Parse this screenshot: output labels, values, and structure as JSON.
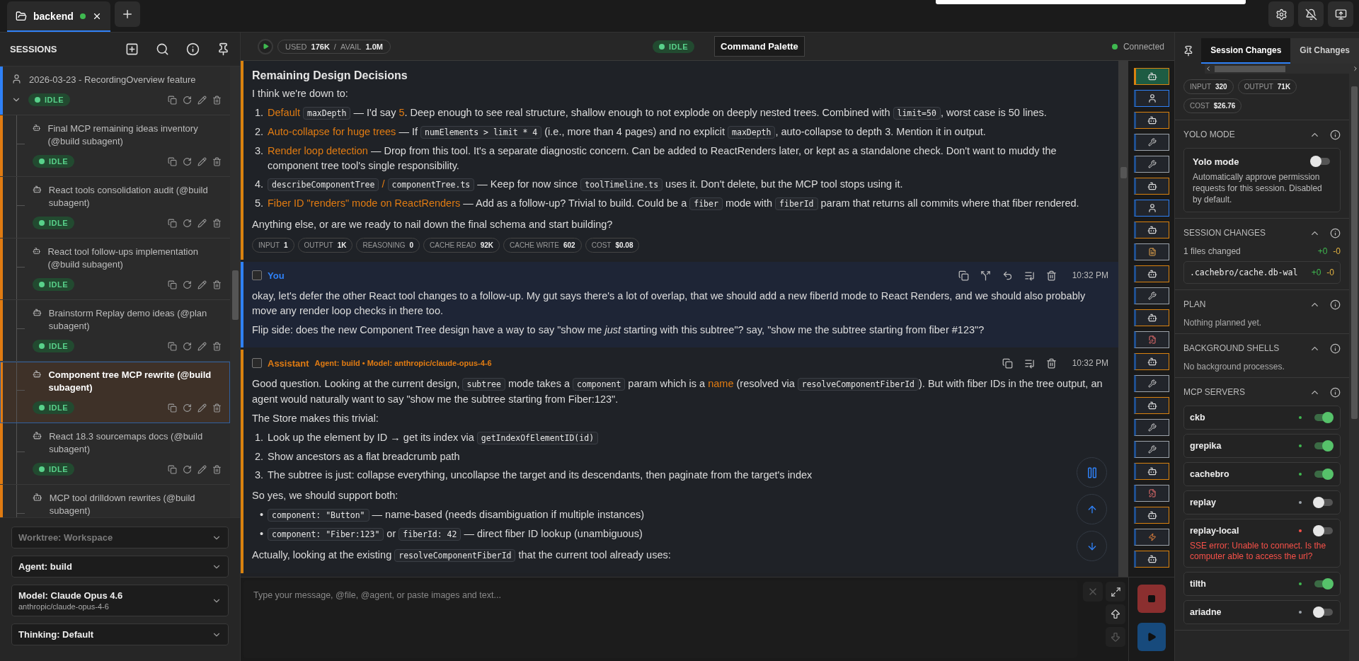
{
  "top_bar": {
    "tabs": [
      {
        "label": "backend",
        "selected": true
      }
    ]
  },
  "sidebar": {
    "title": "SESSIONS",
    "sessions": [
      {
        "kind": "user",
        "title": "2026-03-23 - RecordingOverview feature",
        "status": "IDLE",
        "expanded": true,
        "selected": false,
        "children": [
          {
            "kind": "subagent",
            "title": "Final MCP remaining ideas inventory (@build subagent)",
            "status": "IDLE",
            "selected": false
          },
          {
            "kind": "subagent",
            "title": "React tools consolidation audit (@build subagent)",
            "status": "IDLE",
            "selected": false
          },
          {
            "kind": "subagent",
            "title": "React tool follow-ups implementation (@build subagent)",
            "status": "IDLE",
            "selected": false
          },
          {
            "kind": "subagent",
            "title": "Brainstorm Replay demo ideas (@plan subagent)",
            "status": "IDLE",
            "selected": false
          },
          {
            "kind": "subagent",
            "title": "Component tree MCP rewrite (@build subagent)",
            "status": "IDLE",
            "selected": true
          },
          {
            "kind": "subagent",
            "title": "React 18.3 sourcemaps docs (@build subagent)",
            "status": "IDLE",
            "selected": false
          },
          {
            "kind": "subagent",
            "title": "MCP tool drilldown rewrites (@build subagent)",
            "selected": false
          }
        ]
      }
    ],
    "selects": [
      {
        "label": "Worktree: Workspace",
        "disabled": true
      },
      {
        "label": "Agent: build",
        "disabled": false
      },
      {
        "label": "Model: Claude Opus 4.6",
        "sub": "anthropic/claude-opus-4-6",
        "disabled": false
      },
      {
        "label": "Thinking: Default",
        "disabled": false
      }
    ]
  },
  "header": {
    "used_label": "USED",
    "used": "176K",
    "separator": "/",
    "avail_label": "AVAIL",
    "avail": "1.0M",
    "status": "IDLE",
    "command_palette": "Command Palette",
    "connection": "Connected"
  },
  "messages": [
    {
      "kind": "assistant",
      "blocks": [
        {
          "kind": "heading",
          "text": "Remaining Design Decisions"
        },
        {
          "kind": "para",
          "segments": [
            {
              "kind": "text",
              "text": "I think we're down to:"
            }
          ]
        },
        {
          "kind": "list",
          "items": [
            {
              "marker": "1.",
              "segments": [
                {
                  "kind": "accent",
                  "text": "Default "
                },
                {
                  "kind": "code",
                  "text": "maxDepth"
                },
                {
                  "kind": "text",
                  "text": " — I'd say "
                },
                {
                  "kind": "accent",
                  "text": "5"
                },
                {
                  "kind": "text",
                  "text": ". Deep enough to see real structure, shallow enough to not explode on deeply nested trees. Combined with "
                },
                {
                  "kind": "code",
                  "text": "limit=50"
                },
                {
                  "kind": "text",
                  "text": ", worst case is 50 lines."
                }
              ]
            },
            {
              "marker": "2.",
              "segments": [
                {
                  "kind": "accent",
                  "text": "Auto-collapse for huge trees"
                },
                {
                  "kind": "text",
                  "text": " — If "
                },
                {
                  "kind": "code",
                  "text": "numElements > limit * 4"
                },
                {
                  "kind": "text",
                  "text": " (i.e., more than 4 pages) and no explicit "
                },
                {
                  "kind": "code",
                  "text": "maxDepth"
                },
                {
                  "kind": "text",
                  "text": ", auto-collapse to depth 3. Mention it in output."
                }
              ]
            },
            {
              "marker": "3.",
              "segments": [
                {
                  "kind": "accent",
                  "text": "Render loop detection"
                },
                {
                  "kind": "text",
                  "text": " — Drop from this tool. It's a separate diagnostic concern. Can be added to ReactRenders later, or kept as a standalone check. Don't want to muddy the component tree tool's single responsibility."
                }
              ]
            },
            {
              "marker": "4.",
              "segments": [
                {
                  "kind": "code",
                  "text": "describeComponentTree"
                },
                {
                  "kind": "accent",
                  "text": " / "
                },
                {
                  "kind": "code",
                  "text": "componentTree.ts"
                },
                {
                  "kind": "text",
                  "text": " — Keep for now since "
                },
                {
                  "kind": "code",
                  "text": "toolTimeline.ts"
                },
                {
                  "kind": "text",
                  "text": " uses it. Don't delete, but the MCP tool stops using it."
                }
              ]
            },
            {
              "marker": "5.",
              "segments": [
                {
                  "kind": "accent",
                  "text": "Fiber ID \"renders\" mode on ReactRenders"
                },
                {
                  "kind": "text",
                  "text": " — Add as a follow-up? Trivial to build. Could be a "
                },
                {
                  "kind": "code",
                  "text": "fiber"
                },
                {
                  "kind": "text",
                  "text": " mode with "
                },
                {
                  "kind": "code",
                  "text": "fiberId"
                },
                {
                  "kind": "text",
                  "text": " param that returns all commits where that fiber rendered."
                }
              ]
            }
          ]
        },
        {
          "kind": "para",
          "segments": [
            {
              "kind": "text",
              "text": "Anything else, or are we ready to nail down the final schema and start building?"
            }
          ]
        },
        {
          "kind": "stats",
          "chips": [
            {
              "label": "INPUT",
              "value": "1"
            },
            {
              "label": "OUTPUT",
              "value": "1K"
            },
            {
              "label": "REASONING",
              "value": "0"
            },
            {
              "label": "CACHE READ",
              "value": "92K"
            },
            {
              "label": "CACHE WRITE",
              "value": "602"
            },
            {
              "label": "COST",
              "value": "$0.08"
            }
          ]
        }
      ]
    },
    {
      "kind": "user",
      "author": "You",
      "time": "10:32 PM",
      "checked": false,
      "blocks": [
        {
          "kind": "para",
          "segments": [
            {
              "kind": "text",
              "text": "okay, let's defer the other React tool changes to a follow-up. My gut says there's a lot of overlap, that we should add a new fiberId mode to React Renders, and we should also probably move any render loop checks in there too."
            }
          ]
        },
        {
          "kind": "para",
          "segments": [
            {
              "kind": "text",
              "text": "Flip side: does the new Component Tree design have a way to say \"show me *just* starting with this subtree\"? say, \"show me the subtree starting from fiber #123\"?"
            }
          ]
        }
      ]
    },
    {
      "kind": "assistant",
      "author": "Assistant",
      "meta": "Agent: build • Model: anthropic/claude-opus-4-6",
      "time": "10:32 PM",
      "checked": false,
      "blocks": [
        {
          "kind": "para",
          "segments": [
            {
              "kind": "text",
              "text": "Good question. Looking at the current design, "
            },
            {
              "kind": "code",
              "text": "subtree"
            },
            {
              "kind": "text",
              "text": " mode takes a "
            },
            {
              "kind": "code",
              "text": "component"
            },
            {
              "kind": "text",
              "text": " param which is a "
            },
            {
              "kind": "accent",
              "text": "name"
            },
            {
              "kind": "text",
              "text": " (resolved via "
            },
            {
              "kind": "code",
              "text": "resolveComponentFiberId"
            },
            {
              "kind": "text",
              "text": "). But with fiber IDs in the tree output, an agent would naturally want to say \"show me the subtree starting from Fiber:123\"."
            }
          ]
        },
        {
          "kind": "para",
          "segments": [
            {
              "kind": "text",
              "text": "The Store makes this trivial:"
            }
          ]
        },
        {
          "kind": "list",
          "items": [
            {
              "marker": "1.",
              "segments": [
                {
                  "kind": "text",
                  "text": "Look up the element by ID → get its index via "
                },
                {
                  "kind": "code",
                  "text": "getIndexOfElementID(id)"
                }
              ]
            },
            {
              "marker": "2.",
              "segments": [
                {
                  "kind": "text",
                  "text": "Show ancestors as a flat breadcrumb path"
                }
              ]
            },
            {
              "marker": "3.",
              "segments": [
                {
                  "kind": "text",
                  "text": "The subtree is just: collapse everything, uncollapse the target and its descendants, then paginate from the target's index"
                }
              ]
            }
          ]
        },
        {
          "kind": "para",
          "segments": [
            {
              "kind": "text",
              "text": "So yes, we should support both:"
            }
          ]
        },
        {
          "kind": "list",
          "items": [
            {
              "marker": "•",
              "segments": [
                {
                  "kind": "code",
                  "text": "component: \"Button\""
                },
                {
                  "kind": "text",
                  "text": " — name-based (needs disambiguation if multiple instances)"
                }
              ]
            },
            {
              "marker": "•",
              "segments": [
                {
                  "kind": "code",
                  "text": "component: \"Fiber:123\""
                },
                {
                  "kind": "text",
                  "text": " or "
                },
                {
                  "kind": "code",
                  "text": "fiberId: 42"
                },
                {
                  "kind": "text",
                  "text": " — direct fiber ID lookup (unambiguous)"
                }
              ]
            }
          ]
        },
        {
          "kind": "para",
          "segments": [
            {
              "kind": "text",
              "text": "Actually, looking at the existing "
            },
            {
              "kind": "code",
              "text": "resolveComponentFiberId"
            },
            {
              "kind": "text",
              "text": " that the current tool already uses:"
            }
          ]
        }
      ]
    }
  ],
  "timeline": [
    {
      "kind": "agent",
      "selected": true,
      "color": "#d9820f"
    },
    {
      "kind": "user",
      "selected": false,
      "color": "#2f81f7"
    },
    {
      "kind": "agent",
      "selected": false,
      "color": "#d9820f"
    },
    {
      "kind": "tool",
      "selected": false,
      "color": "#9ca3ab"
    },
    {
      "kind": "tool",
      "selected": false,
      "color": "#9ca3ab"
    },
    {
      "kind": "agent",
      "selected": false,
      "color": "#d9820f"
    },
    {
      "kind": "user",
      "selected": false,
      "color": "#2f81f7"
    },
    {
      "kind": "agent",
      "selected": false,
      "color": "#d9820f"
    },
    {
      "kind": "file",
      "selected": false,
      "color": "#9ca3ab"
    },
    {
      "kind": "agent",
      "selected": false,
      "color": "#d9820f"
    },
    {
      "kind": "tool",
      "selected": false,
      "color": "#9ca3ab"
    },
    {
      "kind": "agent",
      "selected": false,
      "color": "#d9820f"
    },
    {
      "kind": "edit",
      "selected": false,
      "color": "#9ca3ab"
    },
    {
      "kind": "agent",
      "selected": false,
      "color": "#d9820f"
    },
    {
      "kind": "tool",
      "selected": false,
      "color": "#9ca3ab"
    },
    {
      "kind": "agent",
      "selected": false,
      "color": "#d9820f"
    },
    {
      "kind": "tool",
      "selected": false,
      "color": "#9ca3ab"
    },
    {
      "kind": "tool",
      "selected": false,
      "color": "#9ca3ab"
    },
    {
      "kind": "agent",
      "selected": false,
      "color": "#d9820f"
    },
    {
      "kind": "edit",
      "selected": false,
      "color": "#9ca3ab"
    },
    {
      "kind": "agent",
      "selected": false,
      "color": "#d9820f"
    },
    {
      "kind": "event",
      "selected": false,
      "color": "#9ca3ab"
    },
    {
      "kind": "agent",
      "selected": false,
      "color": "#d9820f"
    }
  ],
  "composer": {
    "placeholder": "Type your message, @file, @agent, or paste images and text..."
  },
  "right_panel": {
    "tabs": [
      {
        "label": "Session Changes",
        "selected": true
      },
      {
        "label": "Git Changes",
        "selected": false
      }
    ],
    "stats": [
      {
        "label": "INPUT",
        "value": "320"
      },
      {
        "label": "OUTPUT",
        "value": "71K"
      },
      {
        "label": "COST",
        "value": "$26.76"
      }
    ],
    "sections": [
      {
        "kind": "toggle_card",
        "title": "YOLO MODE",
        "expanded": true,
        "card": {
          "title": "Yolo mode",
          "description": "Automatically approve permission requests for this session. Disabled by default.",
          "on": false
        }
      },
      {
        "kind": "changes",
        "title": "SESSION CHANGES",
        "expanded": true,
        "summary": "1 files changed",
        "added": "+0",
        "removed": "-0",
        "files": [
          {
            "path": ".cachebro/cache.db-wal",
            "added": "+0",
            "removed": "-0"
          }
        ]
      },
      {
        "kind": "note",
        "title": "PLAN",
        "expanded": true,
        "text": "Nothing planned yet."
      },
      {
        "kind": "note",
        "title": "BACKGROUND SHELLS",
        "expanded": true,
        "text": "No background processes."
      },
      {
        "kind": "servers",
        "title": "MCP SERVERS",
        "expanded": true,
        "servers": [
          {
            "name": "ckb",
            "color": "#3fb950",
            "on": true
          },
          {
            "name": "grepika",
            "color": "#3fb950",
            "on": true
          },
          {
            "name": "cachebro",
            "color": "#3fb950",
            "on": true
          },
          {
            "name": "replay",
            "color": "#9ca3ab",
            "on": false
          },
          {
            "name": "replay-local",
            "color": "#f85149",
            "on": false,
            "error": "SSE error: Unable to connect. Is the computer able to access the url?"
          },
          {
            "name": "tilth",
            "color": "#3fb950",
            "on": true
          },
          {
            "name": "ariadne",
            "color": "#9ca3ab",
            "on": false
          }
        ]
      }
    ]
  }
}
